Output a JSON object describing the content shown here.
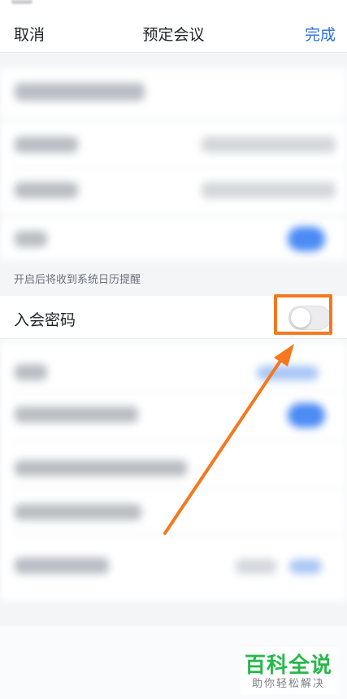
{
  "navbar": {
    "cancel_label": "取消",
    "title": "预定会议",
    "done_label": "完成"
  },
  "reminder_hint": "开启后将收到系统日历提醒",
  "password_row": {
    "label": "入会密码",
    "toggle_state": "off"
  },
  "colors": {
    "accent_blue": "#2b6fd6",
    "annotation_orange": "#f5781f",
    "watermark_green": "#27b84b"
  },
  "watermark": {
    "title": "百科全说",
    "subtitle": "助你轻松解决"
  }
}
